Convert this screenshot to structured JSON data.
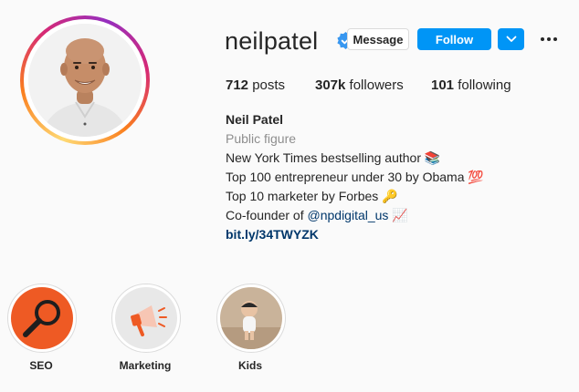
{
  "profile": {
    "username": "neilpatel",
    "message_label": "Message",
    "follow_label": "Follow",
    "stats": {
      "posts_count": "712",
      "posts_label": "posts",
      "followers_count": "307k",
      "followers_label": "followers",
      "following_count": "101",
      "following_label": "following"
    },
    "bio": {
      "name": "Neil Patel",
      "category": "Public figure",
      "line1": "New York Times bestselling author 📚",
      "line2": "Top 100 entrepreneur under 30 by Obama 💯",
      "line3": "Top 10 marketer by Forbes 🔑",
      "line4_prefix": "Co-founder of ",
      "line4_mention": "@npdigital_us",
      "line4_suffix": " 📈",
      "link": "bit.ly/34TWYZK"
    }
  },
  "highlights": [
    {
      "label": "SEO"
    },
    {
      "label": "Marketing"
    },
    {
      "label": "Kids"
    }
  ],
  "colors": {
    "accent": "#0095f6",
    "link": "#00376b",
    "verified": "#3897f0"
  }
}
